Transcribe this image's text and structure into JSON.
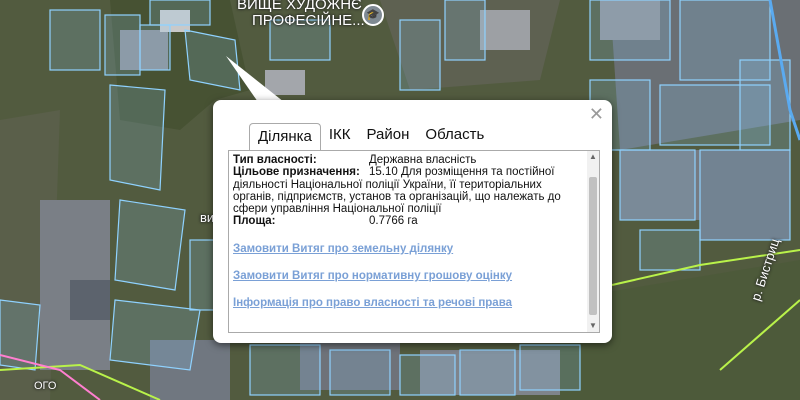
{
  "map": {
    "place_label": "ВИЩЕ ХУДОЖНЄ",
    "place_label_2": "ПРОФЕСІЙНЕ...",
    "poi_icon": "school-icon",
    "street_fragment": "ви",
    "street_fragment_2": "ОГО",
    "river_label": "р. Бистриц",
    "colors": {
      "parcel": "#8fd2ff",
      "road": "#b9f24a",
      "pink_road": "#ff7fd0"
    }
  },
  "popup": {
    "close_icon": "close-icon",
    "tabs": [
      {
        "label": "Ділянка",
        "active": true
      },
      {
        "label": "ІКК",
        "active": false
      },
      {
        "label": "Район",
        "active": false
      },
      {
        "label": "Область",
        "active": false
      }
    ],
    "fields": {
      "ownership_label": "Тип власності:",
      "ownership_value": "Державна власність",
      "purpose_label": "Цільове призначення:",
      "purpose_value_1": "15.10 Для розміщення та постійної",
      "purpose_value_2": "діяльності Національної поліції України, її територіальних",
      "purpose_value_3": "органів, підприємств, установ та організацій, що належать до",
      "purpose_value_4": "сфери управління Національної поліції",
      "area_label": "Площа:",
      "area_value": "0.7766 га"
    },
    "links": {
      "land_extract": "Замовити Витяг про земельну ділянку",
      "valuation_extract": "Замовити Витяг про нормативну грошову оцінку",
      "rights_info": "Інформація про право власності та речові права"
    }
  }
}
